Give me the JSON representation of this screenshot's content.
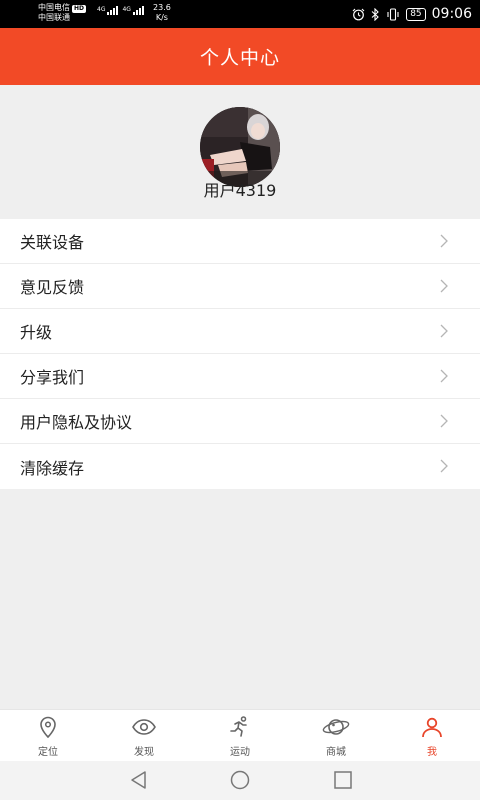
{
  "status_bar": {
    "carrier_1": "中国电信",
    "hd_badge": "HD",
    "carrier_2": "中国联通",
    "network_1": "4G",
    "network_2": "4G",
    "speed_value": "23.6",
    "speed_unit": "K/s",
    "battery": "85",
    "time": "09:06"
  },
  "header": {
    "title": "个人中心"
  },
  "profile": {
    "username": "用户4319"
  },
  "menu": {
    "items": [
      {
        "label": "关联设备"
      },
      {
        "label": "意见反馈"
      },
      {
        "label": "升级"
      },
      {
        "label": "分享我们"
      },
      {
        "label": "用户隐私及协议"
      },
      {
        "label": "清除缓存"
      }
    ]
  },
  "tabbar": {
    "items": [
      {
        "label": "定位",
        "icon": "location-pin-icon"
      },
      {
        "label": "发现",
        "icon": "eye-icon"
      },
      {
        "label": "运动",
        "icon": "runner-icon"
      },
      {
        "label": "商城",
        "icon": "planet-icon"
      },
      {
        "label": "我",
        "icon": "person-icon"
      }
    ],
    "active_index": 4
  },
  "colors": {
    "accent": "#f24a26",
    "active_tab": "#e8452a",
    "background": "#efefef"
  }
}
